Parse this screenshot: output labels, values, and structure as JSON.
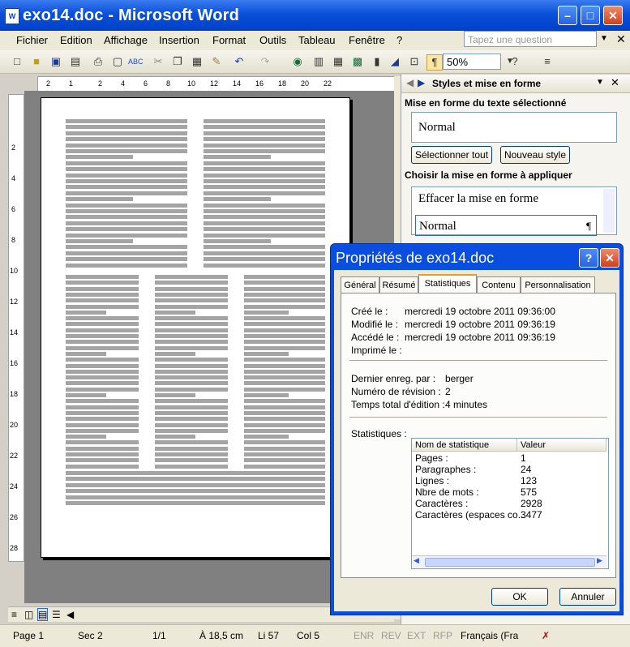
{
  "window": {
    "title": "exo14.doc - Microsoft Word",
    "app_icon_glyph": "W"
  },
  "menu": [
    "Fichier",
    "Edition",
    "Affichage",
    "Insertion",
    "Format",
    "Outils",
    "Tableau",
    "Fenêtre",
    "?"
  ],
  "ask_placeholder": "Tapez une question",
  "toolbar": {
    "zoom": "50%"
  },
  "taskpane": {
    "title": "Styles et mise en forme",
    "section1": "Mise en forme du texte sélectionné",
    "current_style": "Normal",
    "btn_select_all": "Sélectionner tout",
    "btn_new_style": "Nouveau style",
    "section2": "Choisir la mise en forme à appliquer",
    "list": [
      "Effacer la mise en forme",
      "Normal"
    ],
    "pilcrow": "¶"
  },
  "ruler_ticks": [
    "2",
    "1",
    "2",
    "4",
    "6",
    "8",
    "10",
    "12",
    "14",
    "16",
    "18",
    "20",
    "22"
  ],
  "vruler_ticks": [
    "2",
    "4",
    "6",
    "8",
    "10",
    "12",
    "14",
    "16",
    "18",
    "20",
    "22",
    "24",
    "26",
    "28"
  ],
  "dialog": {
    "title": "Propriétés de exo14.doc",
    "tabs": [
      "Général",
      "Résumé",
      "Statistiques",
      "Contenu",
      "Personnalisation"
    ],
    "active_tab": "Statistiques",
    "created_label": "Créé le :",
    "created_value": "mercredi 19 octobre 2011 09:36:00",
    "modified_label": "Modifié le :",
    "modified_value": "mercredi 19 octobre 2011 09:36:19",
    "accessed_label": "Accédé le :",
    "accessed_value": "mercredi 19 octobre 2011 09:36:19",
    "printed_label": "Imprimé le :",
    "saved_by_label": "Dernier enreg. par :",
    "saved_by_value": "berger",
    "revision_label": "Numéro de révision :",
    "revision_value": "2",
    "edit_time_label": "Temps total d'édition :",
    "edit_time_value": "4 minutes",
    "stats_label": "Statistiques :",
    "col_name": "Nom de statistique",
    "col_value": "Valeur",
    "rows": [
      {
        "name": "Pages :",
        "value": "1"
      },
      {
        "name": "Paragraphes :",
        "value": "24"
      },
      {
        "name": "Lignes :",
        "value": "123"
      },
      {
        "name": "Nbre de mots :",
        "value": "575"
      },
      {
        "name": "Caractères :",
        "value": "2928"
      },
      {
        "name": "Caractères (espaces co...",
        "value": "3477"
      }
    ],
    "ok": "OK",
    "cancel": "Annuler",
    "help": "?",
    "close": "✕"
  },
  "status": {
    "page": "Page 1",
    "section": "Sec 2",
    "pages": "1/1",
    "at": "À 18,5 cm",
    "line": "Li 57",
    "col": "Col 5",
    "enr": "ENR",
    "rev": "REV",
    "ext": "EXT",
    "rfp": "RFP",
    "lang": "Français (Fra"
  }
}
